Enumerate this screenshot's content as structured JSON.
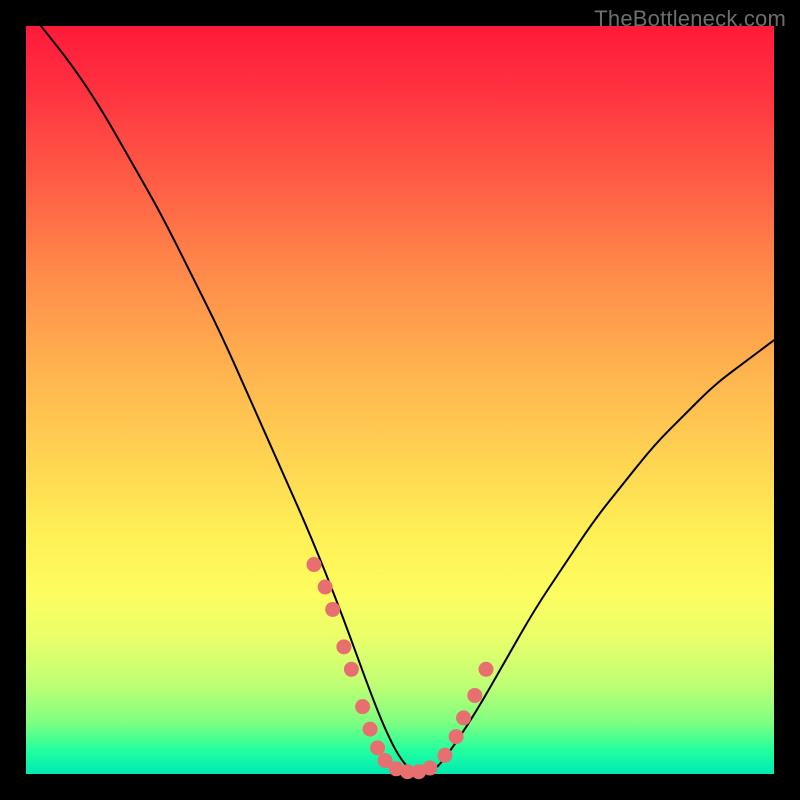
{
  "watermark": "TheBottleneck.com",
  "colors": {
    "dot": "#e76f6f",
    "curve": "#000000",
    "gradient_top": "#ff1a3a",
    "gradient_bottom": "#00e9b2",
    "frame": "#000000"
  },
  "chart_data": {
    "type": "line",
    "title": "",
    "xlabel": "",
    "ylabel": "",
    "xlim": [
      0,
      100
    ],
    "ylim": [
      0,
      100
    ],
    "grid": false,
    "legend": false,
    "annotations": [
      "TheBottleneck.com"
    ],
    "series": [
      {
        "name": "bottleneck-curve",
        "x": [
          2,
          6,
          10,
          14,
          18,
          22,
          26,
          30,
          34,
          38,
          42,
          46,
          48,
          50,
          52,
          54,
          56,
          60,
          64,
          68,
          72,
          76,
          80,
          84,
          88,
          92,
          96,
          100
        ],
        "y": [
          100,
          95,
          89,
          82,
          75,
          67,
          59,
          50,
          41,
          32,
          22,
          11,
          6,
          2,
          0,
          0,
          2,
          8,
          15,
          22,
          28,
          34,
          39,
          44,
          48,
          52,
          55,
          58
        ]
      }
    ],
    "highlight_points": {
      "name": "near-optimum-dots",
      "x": [
        38.5,
        40,
        41,
        42.5,
        43.5,
        45,
        46,
        47,
        48,
        49.5,
        51,
        52.5,
        54,
        56,
        57.5,
        58.5,
        60,
        61.5
      ],
      "y": [
        28,
        25,
        22,
        17,
        14,
        9,
        6,
        3.5,
        1.8,
        0.7,
        0.3,
        0.3,
        0.8,
        2.5,
        5,
        7.5,
        10.5,
        14
      ]
    }
  }
}
